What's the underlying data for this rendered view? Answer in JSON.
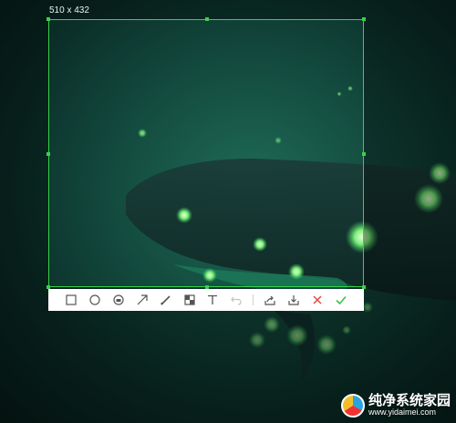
{
  "capture": {
    "size_label": "510 x 432",
    "accent_color": "#38d24a"
  },
  "toolbar": {
    "tools": [
      {
        "name": "rectangle",
        "icon": "square-icon"
      },
      {
        "name": "ellipse",
        "icon": "circle-icon"
      },
      {
        "name": "mosaic",
        "icon": "mosaic-icon"
      },
      {
        "name": "arrow",
        "icon": "arrow-icon"
      },
      {
        "name": "pen",
        "icon": "pen-icon"
      },
      {
        "name": "blur",
        "icon": "blur-icon"
      },
      {
        "name": "text",
        "icon": "text-icon"
      },
      {
        "name": "undo",
        "icon": "undo-icon"
      },
      {
        "name": "share",
        "icon": "share-icon"
      },
      {
        "name": "save",
        "icon": "download-icon"
      },
      {
        "name": "cancel",
        "icon": "close-icon",
        "color": "#e64a3d"
      },
      {
        "name": "confirm",
        "icon": "check-icon",
        "color": "#3cc14a"
      }
    ]
  },
  "watermark": {
    "title": "纯净系统家园",
    "url": "www.yidaimei.com"
  }
}
